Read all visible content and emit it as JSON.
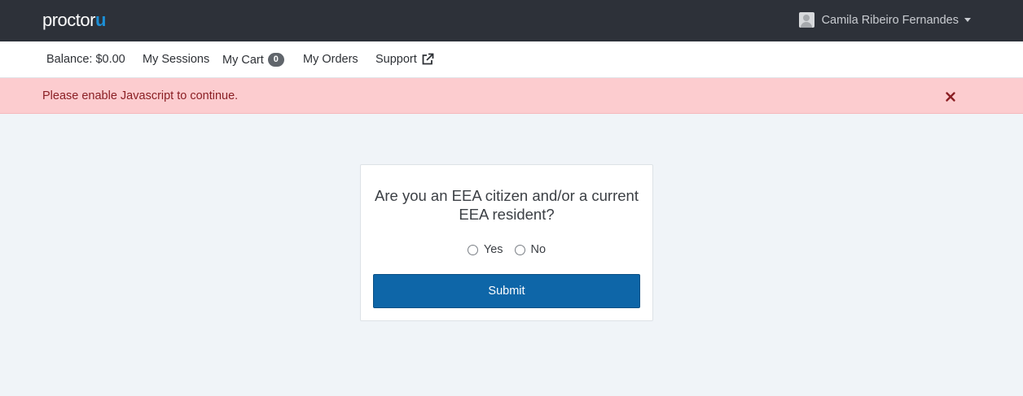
{
  "header": {
    "logo_text": "proctor",
    "logo_accent": "u",
    "user_name": "Camila Ribeiro Fernandes",
    "user_icon": "user-avatar-icon",
    "dropdown_icon": "caret-down-icon"
  },
  "nav": {
    "balance": "Balance: $0.00",
    "sessions": "My Sessions",
    "cart": "My Cart",
    "cart_count": "0",
    "orders": "My Orders",
    "support": "Support",
    "support_icon": "external-link-icon"
  },
  "alert": {
    "message": "Please enable Javascript to continue.",
    "close_icon": "close-icon"
  },
  "form": {
    "question": "Are you an EEA citizen and/or a current EEA resident?",
    "options": [
      "Yes",
      "No"
    ],
    "submit_label": "Submit"
  },
  "colors": {
    "topbar": "#2d3139",
    "brand_accent": "#1c8fd6",
    "alert_bg": "#fccccf",
    "alert_text": "#8a1f24",
    "primary_button": "#0e66a8",
    "page_bg": "#f0f4f8"
  }
}
